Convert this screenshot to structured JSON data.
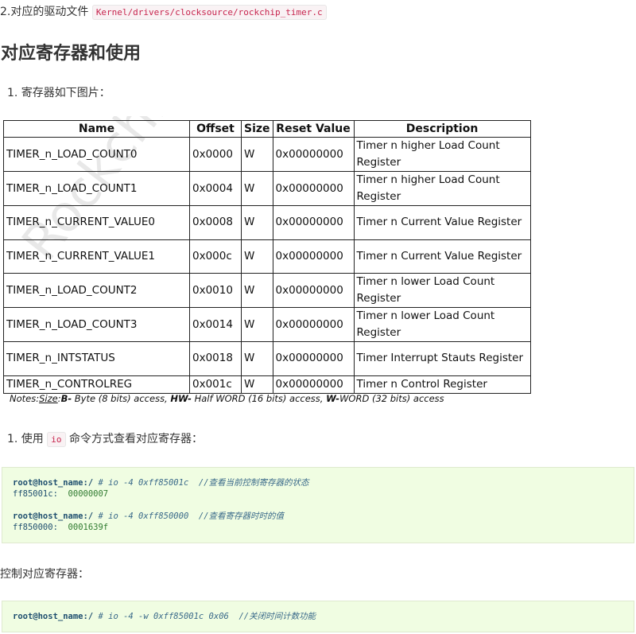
{
  "intro": {
    "text": "2.对应的驱动文件",
    "code": "Kernel/drivers/clocksource/rockchip_timer.c"
  },
  "heading": "对应寄存器和使用",
  "list1": "1. 寄存器如下图片：",
  "table": {
    "watermark": "Rockchip",
    "headers": [
      "Name",
      "Offset",
      "Size",
      "Reset Value",
      "Description"
    ],
    "rows": [
      {
        "name": "TIMER_n_LOAD_COUNT0",
        "offset": "0x0000",
        "size": "W",
        "reset": "0x00000000",
        "desc": "Timer n higher Load Count Register"
      },
      {
        "name": "TIMER_n_LOAD_COUNT1",
        "offset": "0x0004",
        "size": "W",
        "reset": "0x00000000",
        "desc": "Timer n higher Load Count Register"
      },
      {
        "name": "TIMER_n_CURRENT_VALUE0",
        "offset": "0x0008",
        "size": "W",
        "reset": "0x00000000",
        "desc": "Timer n Current Value Register"
      },
      {
        "name": "TIMER_n_CURRENT_VALUE1",
        "offset": "0x000c",
        "size": "W",
        "reset": "0x00000000",
        "desc": "Timer n Current Value Register"
      },
      {
        "name": "TIMER_n_LOAD_COUNT2",
        "offset": "0x0010",
        "size": "W",
        "reset": "0x00000000",
        "desc": "Timer n lower Load Count Register"
      },
      {
        "name": "TIMER_n_LOAD_COUNT3",
        "offset": "0x0014",
        "size": "W",
        "reset": "0x00000000",
        "desc": "Timer n lower Load Count Register"
      },
      {
        "name": "TIMER_n_INTSTATUS",
        "offset": "0x0018",
        "size": "W",
        "reset": "0x00000000",
        "desc": "Timer Interrupt Stauts Register"
      },
      {
        "name": "TIMER_n_CONTROLREG",
        "offset": "0x001c",
        "size": "W",
        "reset": "0x00000000",
        "desc": "Timer n Control Register"
      }
    ],
    "notes": {
      "prefix": "Notes:",
      "size": "Size",
      "colon": ":",
      "b": "B-",
      "b_text": " Byte (8 bits) access, ",
      "hw": "HW-",
      "hw_text": " Half WORD (16 bits) access, ",
      "w": "W-",
      "w_text": "WORD (32 bits) access"
    }
  },
  "list2": {
    "prefix": "1. 使用",
    "code": "io",
    "suffix": "命令方式查看对应寄存器："
  },
  "code1": {
    "l1_prompt": "root@host_name:/",
    "l1_cmd": " # io -4 0xff85001c",
    "l1_comment": "  //查看当前控制寄存器的状态",
    "l2_addr": "ff85001c:",
    "l2_val": "  00000007",
    "l3_prompt": "root@host_name:/",
    "l3_cmd": " # io -4 0xff850000",
    "l3_comment": "  //查看寄存器时时的值",
    "l4_addr": "ff850000:",
    "l4_val": "  0001639f"
  },
  "ctrl_text": "控制对应寄存器：",
  "code2": {
    "prompt": "root@host_name:/",
    "cmd": " # io -4 -w 0xff85001c 0x06",
    "comment": "  //关闭时间计数功能"
  }
}
